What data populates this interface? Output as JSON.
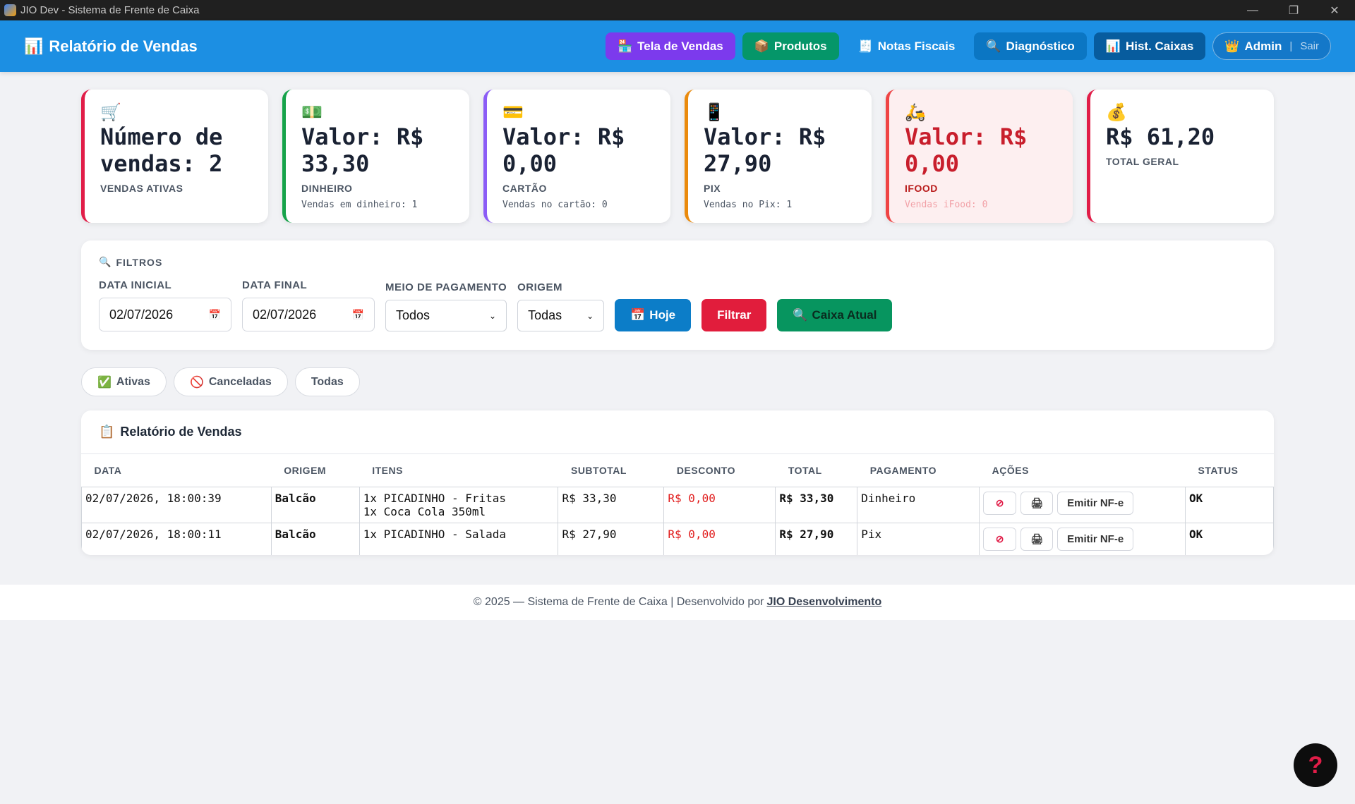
{
  "window": {
    "title": "JIO Dev - Sistema de Frente de Caixa",
    "controls": [
      "—",
      "❐",
      "✕"
    ]
  },
  "header": {
    "icon": "bar-chart-icon",
    "title": "Relatório de Vendas",
    "nav": [
      {
        "label": "Tela de Vendas",
        "icon": "🏪"
      },
      {
        "label": "Produtos",
        "icon": "📦"
      },
      {
        "label": "Notas Fiscais",
        "icon": "🧾"
      },
      {
        "label": "Diagnóstico",
        "icon": "🔍"
      },
      {
        "label": "Hist. Caixas",
        "icon": "📊"
      }
    ],
    "user": {
      "icon": "👑",
      "name": "Admin",
      "separator": "|",
      "logout": "Sair"
    }
  },
  "stats": [
    {
      "icon": "🛒",
      "value": "Número de vendas: 2",
      "label": "VENDAS ATIVAS",
      "sub": ""
    },
    {
      "icon": "💵",
      "value": "Valor: R$ 33,30",
      "label": "DINHEIRO",
      "sub": "Vendas em dinheiro: 1"
    },
    {
      "icon": "💳",
      "value": "Valor: R$ 0,00",
      "label": "CARTÃO",
      "sub": "Vendas no cartão: 0"
    },
    {
      "icon": "📱",
      "value": "Valor: R$ 27,90",
      "label": "PIX",
      "sub": "Vendas no Pix: 1"
    },
    {
      "icon": "🛵",
      "value": "Valor: R$ 0,00",
      "label": "IFOOD",
      "sub": "Vendas iFood: 0"
    },
    {
      "icon": "💰",
      "value": "R$ 61,20",
      "label": "TOTAL GERAL",
      "sub": ""
    }
  ],
  "filters": {
    "title": "FILTROS",
    "date_start_label": "DATA INICIAL",
    "date_start": "02/07/2026",
    "date_end_label": "DATA FINAL",
    "date_end": "02/07/2026",
    "payment_label": "MEIO DE PAGAMENTO",
    "payment_value": "Todos",
    "origin_label": "ORIGEM",
    "origin_value": "Todas",
    "today_btn": "Hoje",
    "filter_btn": "Filtrar",
    "cash_btn": "Caixa Atual"
  },
  "tabs": [
    {
      "icon": "✅",
      "label": "Ativas"
    },
    {
      "icon": "🚫",
      "label": "Canceladas"
    },
    {
      "icon": "",
      "label": "Todas"
    }
  ],
  "report": {
    "title": "Relatório de Vendas",
    "columns": [
      "DATA",
      "ORIGEM",
      "ITENS",
      "SUBTOTAL",
      "DESCONTO",
      "TOTAL",
      "PAGAMENTO",
      "AÇÕES",
      "STATUS"
    ],
    "rows": [
      {
        "date": "02/07/2026, 18:00:39",
        "origin": "Balcão",
        "items": [
          "1x PICADINHO - Fritas",
          "1x Coca Cola 350ml"
        ],
        "subtotal": "R$ 33,30",
        "discount": "R$ 0,00",
        "total": "R$ 33,30",
        "payment": "Dinheiro",
        "nfe": "Emitir NF-e",
        "status": "OK"
      },
      {
        "date": "02/07/2026, 18:00:11",
        "origin": "Balcão",
        "items": [
          "1x PICADINHO - Salada"
        ],
        "subtotal": "R$ 27,90",
        "discount": "R$ 0,00",
        "total": "R$ 27,90",
        "payment": "Pix",
        "nfe": "Emitir NF-e",
        "status": "OK"
      }
    ]
  },
  "footer": {
    "text": "© 2025 — Sistema de Frente de Caixa | Desenvolvido por",
    "link": "JIO Desenvolvimento"
  },
  "help_button": "?"
}
